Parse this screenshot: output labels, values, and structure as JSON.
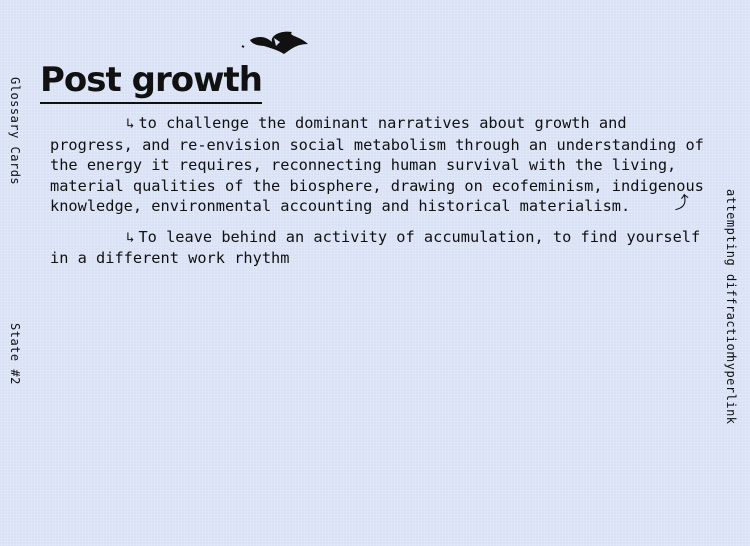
{
  "sidebar_left": {
    "glossary": "Glossary Cards",
    "state": "State #2"
  },
  "sidebar_right": {
    "diffraction": "attempting diffraction",
    "hyperlink": "hyperlink"
  },
  "card": {
    "title": "Post growth",
    "paragraphs": [
      {
        "arrow": "↳",
        "text": "to challenge the dominant narratives about growth and progress, and re-envision social metabolism through an understanding of the energy it requires, reconnecting human survival with the living, material qualities of the biosphere, drawing on ecofeminism, indigenous knowledge, environmental accounting and historical materialism.",
        "end_arrow": "⤴"
      },
      {
        "arrow": "↳",
        "text": "To leave behind an activity of accumulation, to find yourself in a different work rhythm"
      }
    ]
  },
  "icons": {
    "bird": "bird-icon",
    "arrow": "return-arrow-icon",
    "link_arrow": "curved-up-arrow-icon"
  },
  "colors": {
    "background": "#d9e1f5",
    "text": "#111111"
  }
}
